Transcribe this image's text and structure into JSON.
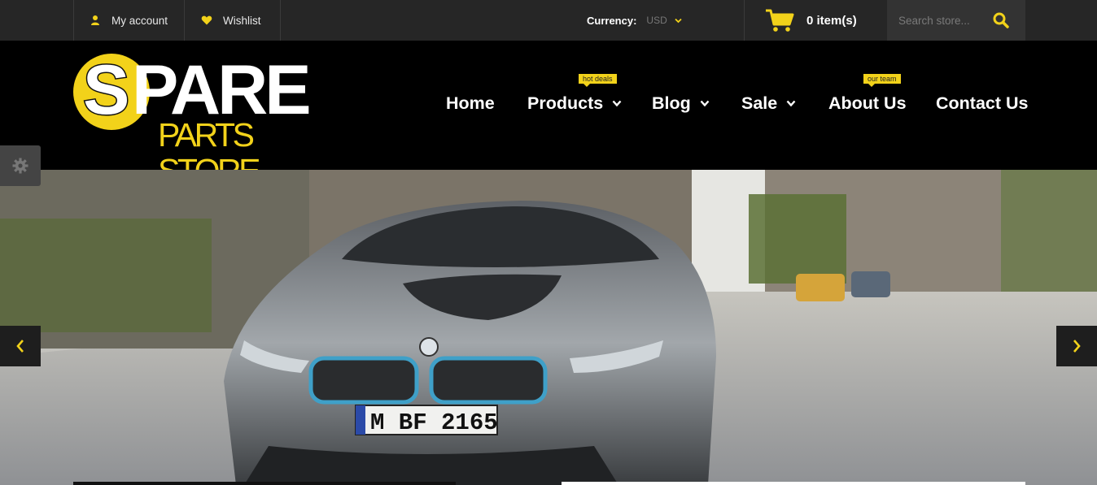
{
  "topbar": {
    "account_label": "My account",
    "wishlist_label": "Wishlist",
    "currency_label": "Currency:",
    "currency_value": "USD",
    "cart_label": "0 item(s)",
    "search_placeholder": "Search store..."
  },
  "logo": {
    "initial": "S",
    "word": "PARE",
    "sub": "PARTS STORE"
  },
  "nav": {
    "items": [
      {
        "label": "Home"
      },
      {
        "label": "Products",
        "badge": "hot deals"
      },
      {
        "label": "Blog"
      },
      {
        "label": "Sale"
      },
      {
        "label": "About Us",
        "badge": "our team"
      },
      {
        "label": "Contact Us"
      }
    ]
  },
  "slider": {
    "plate": "M BF 2165"
  },
  "colors": {
    "accent": "#f2d21a",
    "topbar_bg": "#262626",
    "header_bg": "#000000"
  },
  "icons": {
    "account": "user-icon",
    "wishlist": "heart-icon",
    "currency": "chevron-down-icon",
    "cart": "shopping-cart-icon",
    "search": "search-icon",
    "settings": "gear-icon",
    "prev": "chevron-left-icon",
    "next": "chevron-right-icon"
  }
}
